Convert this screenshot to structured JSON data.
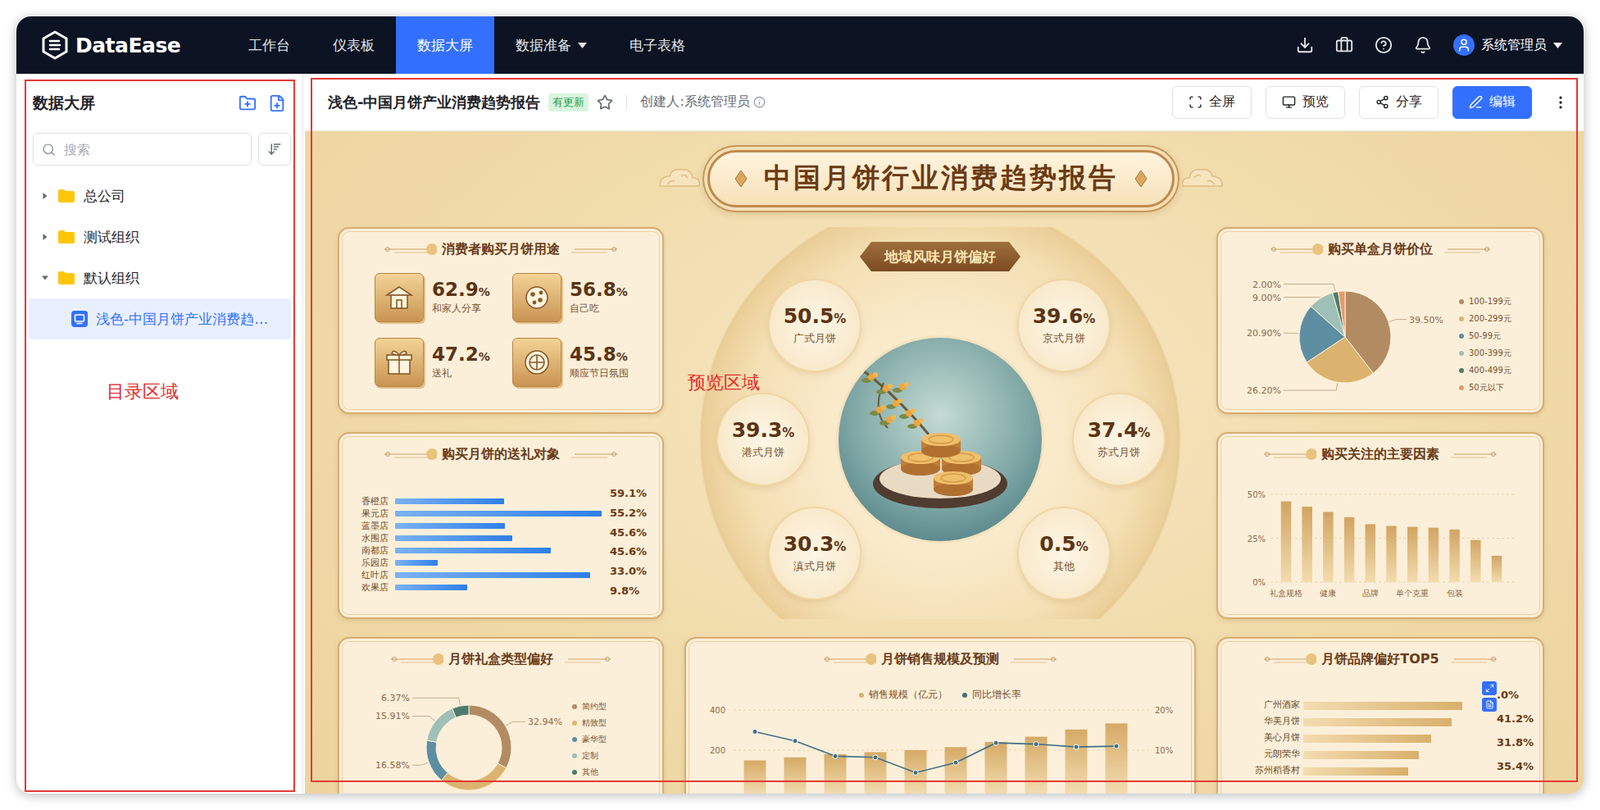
{
  "app": {
    "logo": "DataEase"
  },
  "nav": {
    "items": [
      {
        "label": "工作台",
        "selected": false,
        "menu": false
      },
      {
        "label": "仪表板",
        "selected": false,
        "menu": false
      },
      {
        "label": "数据大屏",
        "selected": true,
        "menu": false
      },
      {
        "label": "数据准备",
        "selected": false,
        "menu": true
      },
      {
        "label": "电子表格",
        "selected": false,
        "menu": false
      }
    ],
    "user": {
      "name": "系统管理员",
      "menu": true
    }
  },
  "sidebar": {
    "title": "数据大屏",
    "search": {
      "placeholder": "搜索"
    },
    "tree": [
      {
        "label": "总公司",
        "expanded": false,
        "selected": false,
        "children": []
      },
      {
        "label": "测试组织",
        "expanded": false,
        "selected": false,
        "children": []
      },
      {
        "label": "默认组织",
        "expanded": true,
        "selected": false,
        "children": [
          {
            "label": "浅色-中国月饼产业消费趋…",
            "selected": true
          }
        ]
      }
    ],
    "annotation": "目录区域"
  },
  "preview": {
    "header": {
      "title": "浅色-中国月饼产业消费趋势报告",
      "badge": "有更新",
      "starred": false,
      "creator": "创建人:系统管理员",
      "buttons": [
        {
          "label": "全屏",
          "primary": false
        },
        {
          "label": "预览",
          "primary": false
        },
        {
          "label": "分享",
          "primary": false
        },
        {
          "label": "编辑",
          "primary": true
        }
      ]
    },
    "annotation": "预览区域",
    "dashboard": {
      "title": "中国月饼行业消费趋势报告",
      "usage": {
        "title": "消费者购买月饼用途",
        "items": [
          {
            "value": "62.9",
            "unit": "%",
            "label": "和家人分享"
          },
          {
            "value": "56.8",
            "unit": "%",
            "label": "自己吃"
          },
          {
            "value": "47.2",
            "unit": "%",
            "label": "送礼"
          },
          {
            "value": "45.8",
            "unit": "%",
            "label": "顺应节日氛围"
          }
        ]
      },
      "gift_targets": {
        "title": "购买月饼的送礼对象",
        "max": 100,
        "bars": [
          {
            "label": "香橙店",
            "value": 52.6
          },
          {
            "label": "果元店",
            "value": 100
          },
          {
            "label": "蓝墨店",
            "value": 53.1
          },
          {
            "label": "水围店",
            "value": 56.7
          },
          {
            "label": "南都店",
            "value": 75.3
          },
          {
            "label": "乐园店",
            "value": 20.6
          },
          {
            "label": "红叶店",
            "value": 94.3
          },
          {
            "label": "欢果店",
            "value": 35.1
          }
        ],
        "readings": [
          "59.1%",
          "55.2%",
          "45.6%",
          "45.6%",
          "33.0%",
          "9.8%"
        ]
      },
      "price": {
        "title": "购买单盒月饼价位",
        "slices": [
          {
            "name": "100-199元",
            "value": 39.5,
            "label": "39.50%",
            "color": "#b38b63"
          },
          {
            "name": "200-299元",
            "value": 26.2,
            "label": "26.20%",
            "color": "#dcb36e"
          },
          {
            "name": "50-99元",
            "value": 20.9,
            "label": "20.90%",
            "color": "#5d8ea2"
          },
          {
            "name": "300-399元",
            "value": 9.0,
            "label": "9.00%",
            "color": "#9fc0b6"
          },
          {
            "name": "400-499元",
            "value": 2.0,
            "label": "2.00%",
            "color": "#4d7b6c"
          },
          {
            "name": "50元以下",
            "value": 2.4,
            "color": "#e59a6a"
          }
        ]
      },
      "regional": {
        "title": "地域风味月饼偏好",
        "items": [
          {
            "value": "50.5",
            "unit": "%",
            "label": "广式月饼"
          },
          {
            "value": "39.6",
            "unit": "%",
            "label": "京式月饼"
          },
          {
            "value": "39.3",
            "unit": "%",
            "label": "港式月饼"
          },
          {
            "value": "37.4",
            "unit": "%",
            "label": "苏式月饼"
          },
          {
            "value": "30.3",
            "unit": "%",
            "label": "滇式月饼"
          },
          {
            "value": "0.5",
            "unit": "%",
            "label": "其他"
          }
        ]
      },
      "factors": {
        "title": "购买关注的主要因素",
        "y_max": 50,
        "y_ticks": [
          "50%",
          "25%",
          "0%"
        ],
        "x_labels": [
          "礼盒规格",
          "健康",
          "品牌",
          "单个克重",
          "包装"
        ],
        "values": [
          46,
          43,
          40,
          37,
          33,
          32,
          31.5,
          31,
          30,
          24,
          15
        ]
      },
      "gift_box": {
        "title": "月饼礼盒类型偏好",
        "slices": [
          {
            "name": "简约型",
            "value": 32.94,
            "label": "32.94%",
            "color": "#b38b63"
          },
          {
            "name": "精致型",
            "value": 28.2,
            "color": "#dcb36e"
          },
          {
            "name": "豪华型",
            "value": 16.58,
            "label": "16.58%",
            "color": "#5d8ea2"
          },
          {
            "name": "定制",
            "value": 15.91,
            "label": "15.91%",
            "color": "#9fc0b6"
          },
          {
            "name": "其他",
            "value": 6.37,
            "label": "6.37%",
            "color": "#4d7b6c"
          }
        ]
      },
      "sales": {
        "title": "月饼销售规模及预测",
        "legend": [
          {
            "label": "销售规模（亿元）",
            "color": "#d9b06c"
          },
          {
            "label": "同比增长率",
            "color": "#3f6f86"
          }
        ],
        "left_max": 400,
        "right_max": 20,
        "left_ticks": [
          "400",
          "200"
        ],
        "right_ticks": [
          "20%",
          "10%"
        ],
        "bars": [
          149,
          164,
          180,
          190,
          200,
          215,
          241,
          267,
          303,
          333
        ],
        "growth": [
          14.6,
          12.3,
          8.5,
          8.2,
          4.4,
          6.9,
          11.8,
          11.5,
          10.8,
          11.0
        ]
      },
      "brands": {
        "title": "月饼品牌偏好TOP5",
        "hovered": true,
        "max": 180,
        "items": [
          {
            "label": "广州酒家",
            "value": 153
          },
          {
            "label": "华美月饼",
            "value": 143
          },
          {
            "label": "美心月饼",
            "value": 123
          },
          {
            "label": "元朗荣华",
            "value": 111
          },
          {
            "label": "苏州稻香村",
            "value": 101
          }
        ],
        "readings": [
          ".0%",
          "41.2%",
          "31.8%",
          "35.4%"
        ]
      }
    }
  }
}
